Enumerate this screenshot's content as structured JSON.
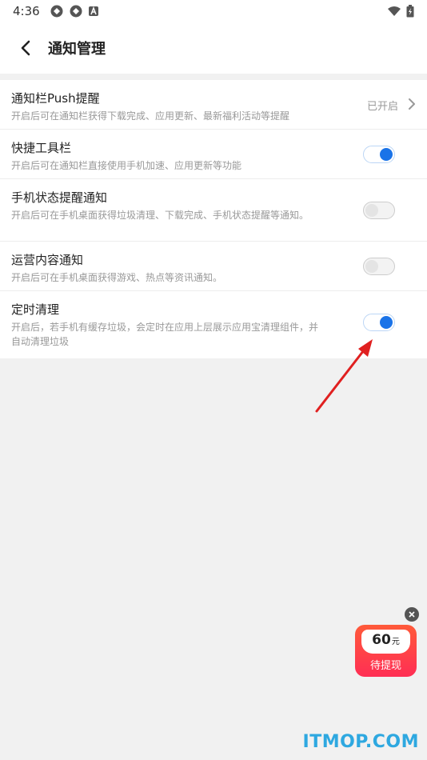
{
  "status_bar": {
    "time": "4:36",
    "left_icons": [
      "app-icon",
      "app-icon",
      "a-icon"
    ],
    "right_icons": [
      "wifi-icon",
      "battery-icon"
    ]
  },
  "header": {
    "title": "通知管理",
    "back_icon": "back-arrow-icon"
  },
  "settings": [
    {
      "key": "push",
      "title": "通知栏Push提醒",
      "desc": "开启后可在通知栏获得下载完成、应用更新、最新福利活动等提醒",
      "status_text": "已开启",
      "control": "chevron"
    },
    {
      "key": "quick",
      "title": "快捷工具栏",
      "desc": "开启后可在通知栏直接使用手机加速、应用更新等功能",
      "toggle": true
    },
    {
      "key": "status",
      "title": "手机状态提醒通知",
      "desc": "开启后可在手机桌面获得垃圾清理、下载完成、手机状态提醒等通知。",
      "toggle": false
    },
    {
      "key": "ops",
      "title": "运营内容通知",
      "desc": "开启后可在手机桌面获得游戏、热点等资讯通知。",
      "toggle": false
    },
    {
      "key": "clean",
      "title": "定时清理",
      "desc": "开启后，若手机有缓存垃圾，会定时在应用上层展示应用宝清理组件，并自动清理垃圾",
      "toggle": true
    }
  ],
  "promo": {
    "amount": "60",
    "unit": "元",
    "label": "待提现"
  },
  "watermark": "ITMOP.COM",
  "colors": {
    "accent": "#1a73e8",
    "arrow": "#e02020",
    "watermark": "#2ea8e0"
  }
}
